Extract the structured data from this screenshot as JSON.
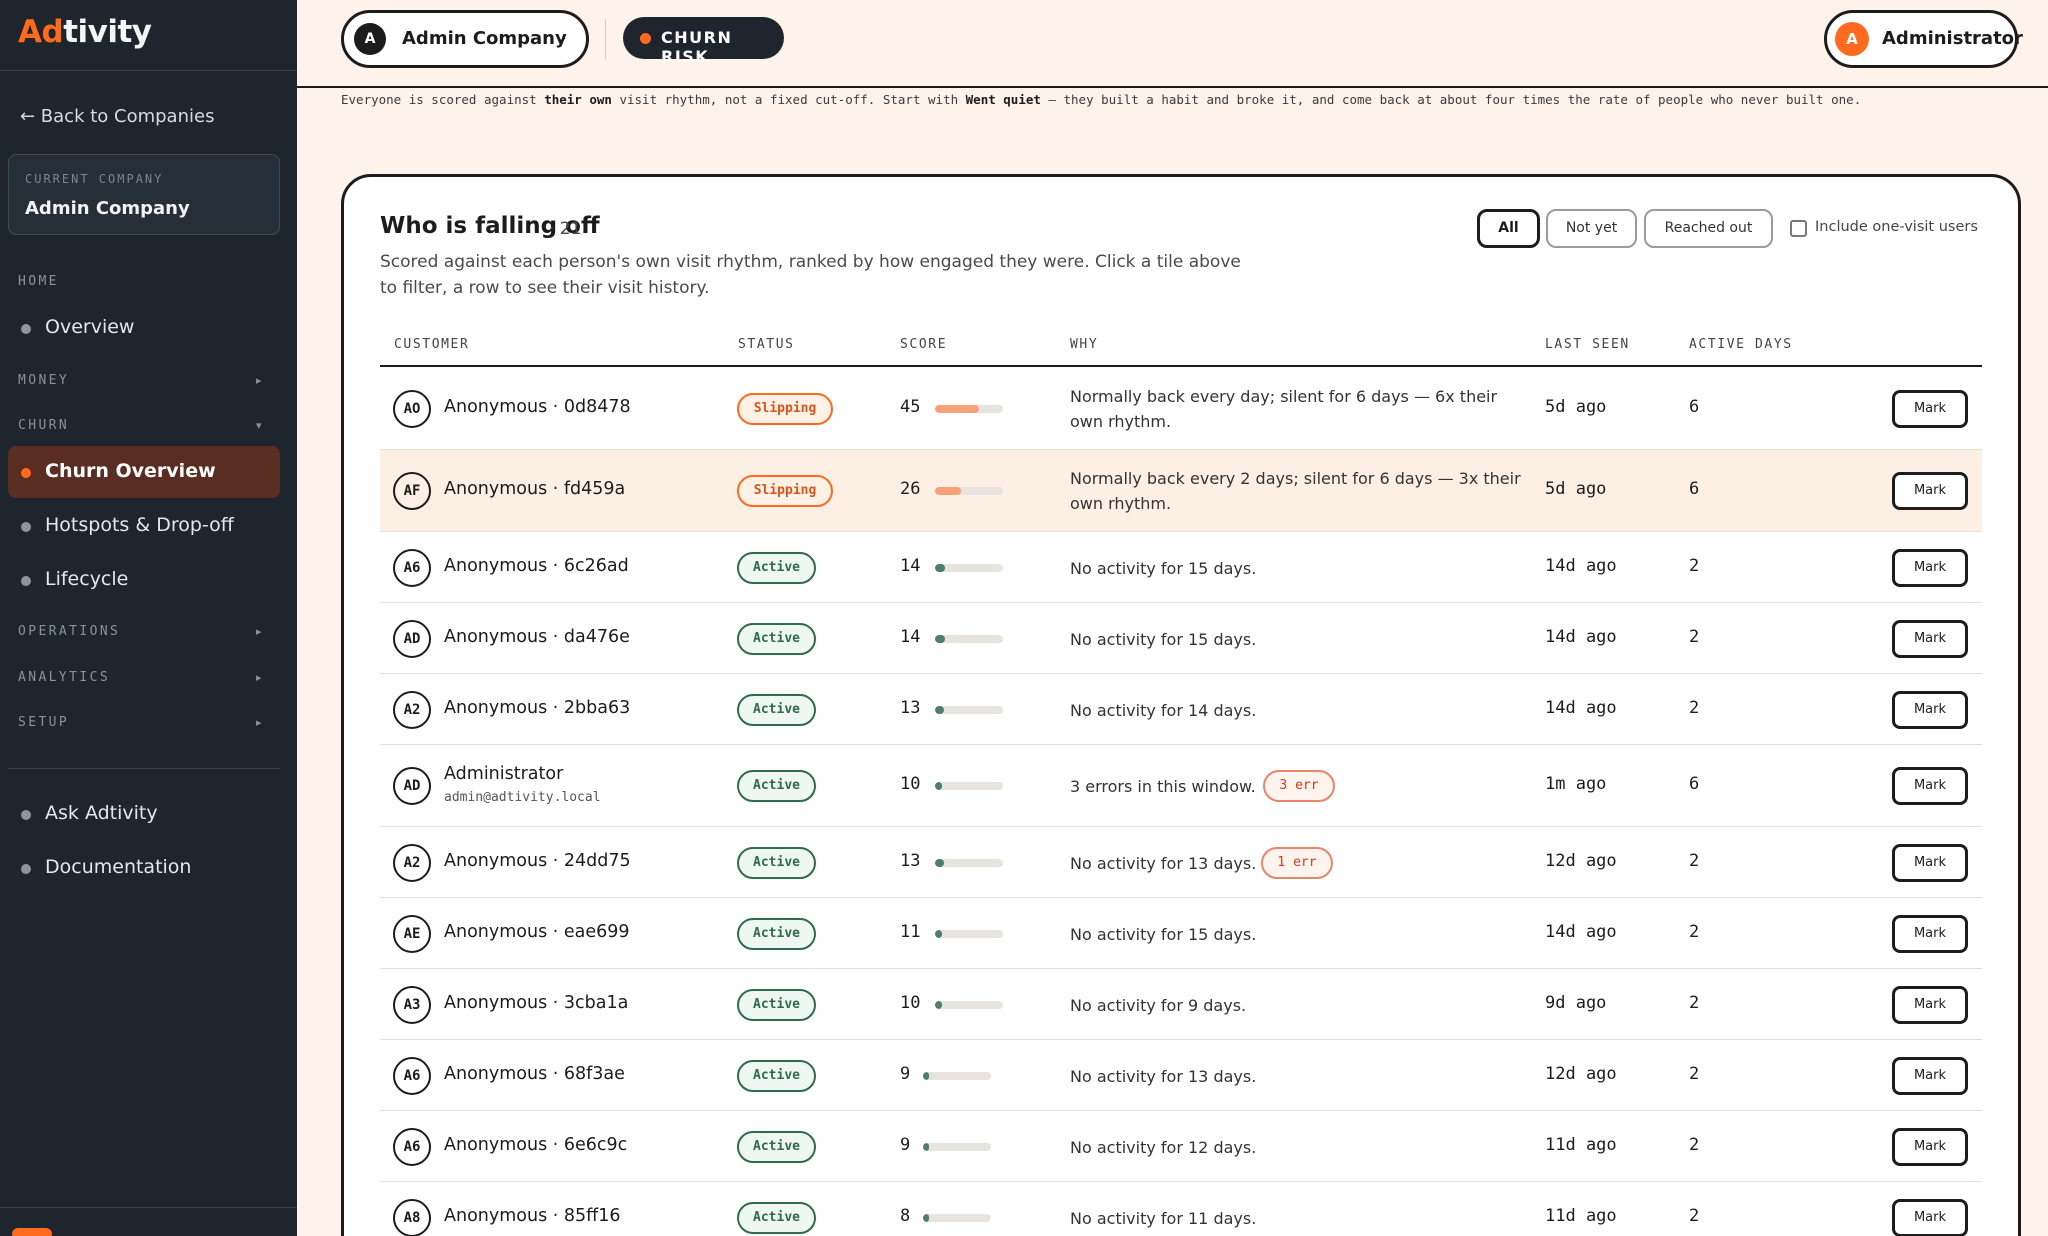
{
  "app": {
    "logo_prefix": "Ad",
    "logo_suffix": "tivity"
  },
  "colors": {
    "accent": "#ff6a1f",
    "sidebar": "#1e252d",
    "active_green": "#2f6b4d",
    "slipping_orange": "#ff6a1f",
    "error_red": "#cf3d1d"
  },
  "sidebar": {
    "back": "← Back to Companies",
    "current_company_label": "CURRENT COMPANY",
    "current_company": "Admin Company",
    "sections": {
      "home": "HOME",
      "money": "MONEY",
      "churn": "CHURN",
      "operations": "OPERATIONS",
      "analytics": "ANALYTICS",
      "setup": "SETUP"
    },
    "items": {
      "overview": "Overview",
      "churn_overview": "Churn Overview",
      "hotspots": "Hotspots & Drop-off",
      "lifecycle": "Lifecycle",
      "ask": "Ask Adtivity",
      "docs": "Documentation"
    },
    "icons": {
      "expand": "chevron-right-icon",
      "collapse": "chevron-down-icon"
    }
  },
  "topbar": {
    "company_initial": "A",
    "company_name": "Admin Company",
    "company_chevron": "⌄",
    "risk_label": "CHURN RISK",
    "user_initial": "A",
    "user_name": "Administrator"
  },
  "intro": {
    "p1": "Everyone is scored against ",
    "b1": "their own",
    "p2": " visit rhythm, not a fixed cut-off. Start with ",
    "b2": "Went quiet",
    "p3": " — they built a habit and broke it, and come back at about four times the rate of people who never built one."
  },
  "card": {
    "title": "Who is falling off",
    "count": "· 21",
    "subtitle": "Scored against each person's own visit rhythm, ranked by how engaged they were. Click a tile above to filter, a row to see their visit history.",
    "filters": {
      "all": "All",
      "not_yet": "Not yet",
      "reached_out": "Reached out"
    },
    "include_one_visit": "Include one-visit users",
    "include_one_visit_checked": false,
    "columns": {
      "customer": "CUSTOMER",
      "status": "STATUS",
      "score": "SCORE",
      "why": "WHY",
      "last_seen": "LAST SEEN",
      "active_days": "ACTIVE DAYS"
    },
    "mark_label": "Mark"
  },
  "rows": [
    {
      "initials": "AO",
      "name": "Anonymous · 0d8478",
      "sub": "",
      "status": "Slipping",
      "status_kind": "slip",
      "score": 45,
      "why": "Normally back every day; silent for 6 days — 6x their own rhythm.",
      "err": "",
      "last_seen": "5d ago",
      "active_days": "6",
      "highlight": false
    },
    {
      "initials": "AF",
      "name": "Anonymous · fd459a",
      "sub": "",
      "status": "Slipping",
      "status_kind": "slip",
      "score": 26,
      "why": "Normally back every 2 days; silent for 6 days — 3x their own rhythm.",
      "err": "",
      "last_seen": "5d ago",
      "active_days": "6",
      "highlight": true
    },
    {
      "initials": "A6",
      "name": "Anonymous · 6c26ad",
      "sub": "",
      "status": "Active",
      "status_kind": "act",
      "score": 14,
      "why": "No activity for 15 days.",
      "err": "",
      "last_seen": "14d ago",
      "active_days": "2",
      "highlight": false
    },
    {
      "initials": "AD",
      "name": "Anonymous · da476e",
      "sub": "",
      "status": "Active",
      "status_kind": "act",
      "score": 14,
      "why": "No activity for 15 days.",
      "err": "",
      "last_seen": "14d ago",
      "active_days": "2",
      "highlight": false
    },
    {
      "initials": "A2",
      "name": "Anonymous · 2bba63",
      "sub": "",
      "status": "Active",
      "status_kind": "act",
      "score": 13,
      "why": "No activity for 14 days.",
      "err": "",
      "last_seen": "14d ago",
      "active_days": "2",
      "highlight": false
    },
    {
      "initials": "AD",
      "name": "Administrator",
      "sub": "admin@adtivity.local",
      "status": "Active",
      "status_kind": "act",
      "score": 10,
      "why": "3 errors in this window.",
      "err": "3 err",
      "last_seen": "1m ago",
      "active_days": "6",
      "highlight": false
    },
    {
      "initials": "A2",
      "name": "Anonymous · 24dd75",
      "sub": "",
      "status": "Active",
      "status_kind": "act",
      "score": 13,
      "why": "No activity for 13 days.",
      "err": "1 err",
      "last_seen": "12d ago",
      "active_days": "2",
      "highlight": false
    },
    {
      "initials": "AE",
      "name": "Anonymous · eae699",
      "sub": "",
      "status": "Active",
      "status_kind": "act",
      "score": 11,
      "why": "No activity for 15 days.",
      "err": "",
      "last_seen": "14d ago",
      "active_days": "2",
      "highlight": false
    },
    {
      "initials": "A3",
      "name": "Anonymous · 3cba1a",
      "sub": "",
      "status": "Active",
      "status_kind": "act",
      "score": 10,
      "why": "No activity for 9 days.",
      "err": "",
      "last_seen": "9d ago",
      "active_days": "2",
      "highlight": false
    },
    {
      "initials": "A6",
      "name": "Anonymous · 68f3ae",
      "sub": "",
      "status": "Active",
      "status_kind": "act",
      "score": 9,
      "why": "No activity for 13 days.",
      "err": "",
      "last_seen": "12d ago",
      "active_days": "2",
      "highlight": false
    },
    {
      "initials": "A6",
      "name": "Anonymous · 6e6c9c",
      "sub": "",
      "status": "Active",
      "status_kind": "act",
      "score": 9,
      "why": "No activity for 12 days.",
      "err": "",
      "last_seen": "11d ago",
      "active_days": "2",
      "highlight": false
    },
    {
      "initials": "A8",
      "name": "Anonymous · 85ff16",
      "sub": "",
      "status": "Active",
      "status_kind": "act",
      "score": 8,
      "why": "No activity for 11 days.",
      "err": "",
      "last_seen": "11d ago",
      "active_days": "2",
      "highlight": false
    }
  ]
}
